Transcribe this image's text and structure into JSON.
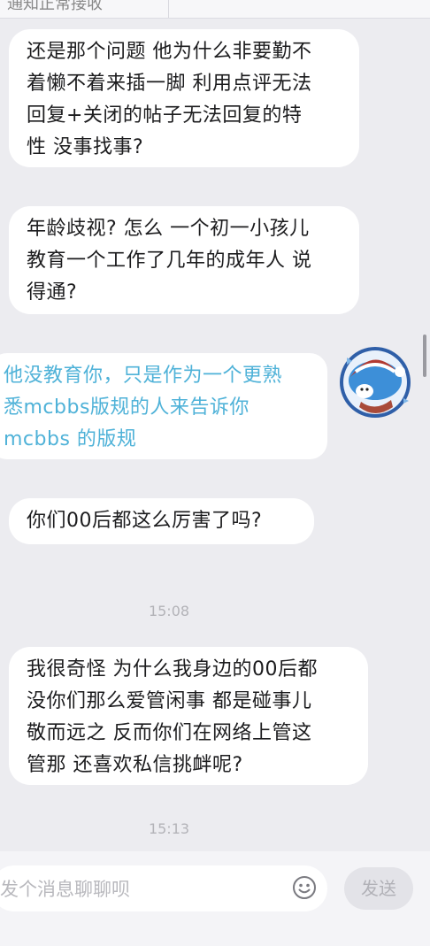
{
  "header": {
    "notice": "通知正常接收"
  },
  "messages": [
    {
      "side": "other",
      "lines": [
        "还是那个问题 他为什么非要勤不",
        "着懒不着来插一脚 利用点评无法",
        "回复+关闭的帖子无法回复的特",
        "性 没事找事?"
      ]
    },
    {
      "side": "other",
      "lines": [
        "年龄歧视? 怎么 一个初一小孩儿",
        "教育一个工作了几年的成年人 说",
        "得通?"
      ]
    },
    {
      "side": "self",
      "lines": [
        "他没教育你，只是作为一个更熟",
        "悉mcbbs版规的人来告诉你",
        "mcbbs 的版规"
      ]
    },
    {
      "side": "other",
      "lines": [
        "你们00后都这么厉害了吗?"
      ]
    },
    {
      "side": "other",
      "lines": [
        "我很奇怪 为什么我身边的00后都",
        "没你们那么爱管闲事 都是碰事儿",
        "敬而远之 反而你们在网络上管这",
        "管那 还喜欢私信挑衅呢?"
      ]
    }
  ],
  "timestamps": [
    "15:08",
    "15:13"
  ],
  "composer": {
    "placeholder": "发个消息聊聊呗",
    "send_label": "发送",
    "emoji_icon": "smiley-icon"
  },
  "colors": {
    "background": "#ececf0",
    "self_text": "#4fb2d8",
    "bubble": "#ffffff"
  }
}
